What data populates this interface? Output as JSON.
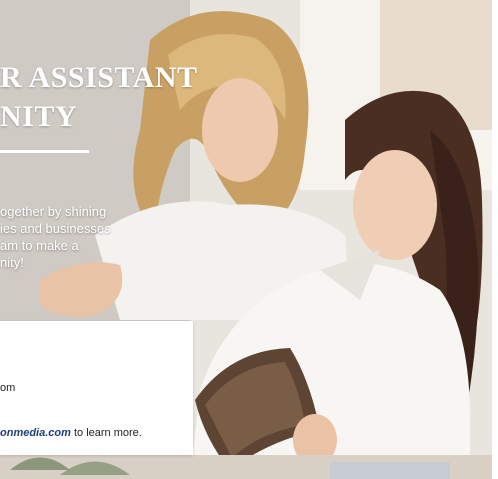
{
  "ad": {
    "headline_line1": "R ASSISTANT",
    "headline_line2": "NITY",
    "body_lines": [
      "ogether by shining",
      "ies and businesses",
      "am to make a",
      "nity!"
    ],
    "card": {
      "email_fragment": "om",
      "cta_domain": "onmedia.com",
      "cta_rest": " to learn more."
    }
  },
  "colors": {
    "headline": "#ffffff",
    "link": "#1c3f7a",
    "card_background": "#ffffff"
  }
}
